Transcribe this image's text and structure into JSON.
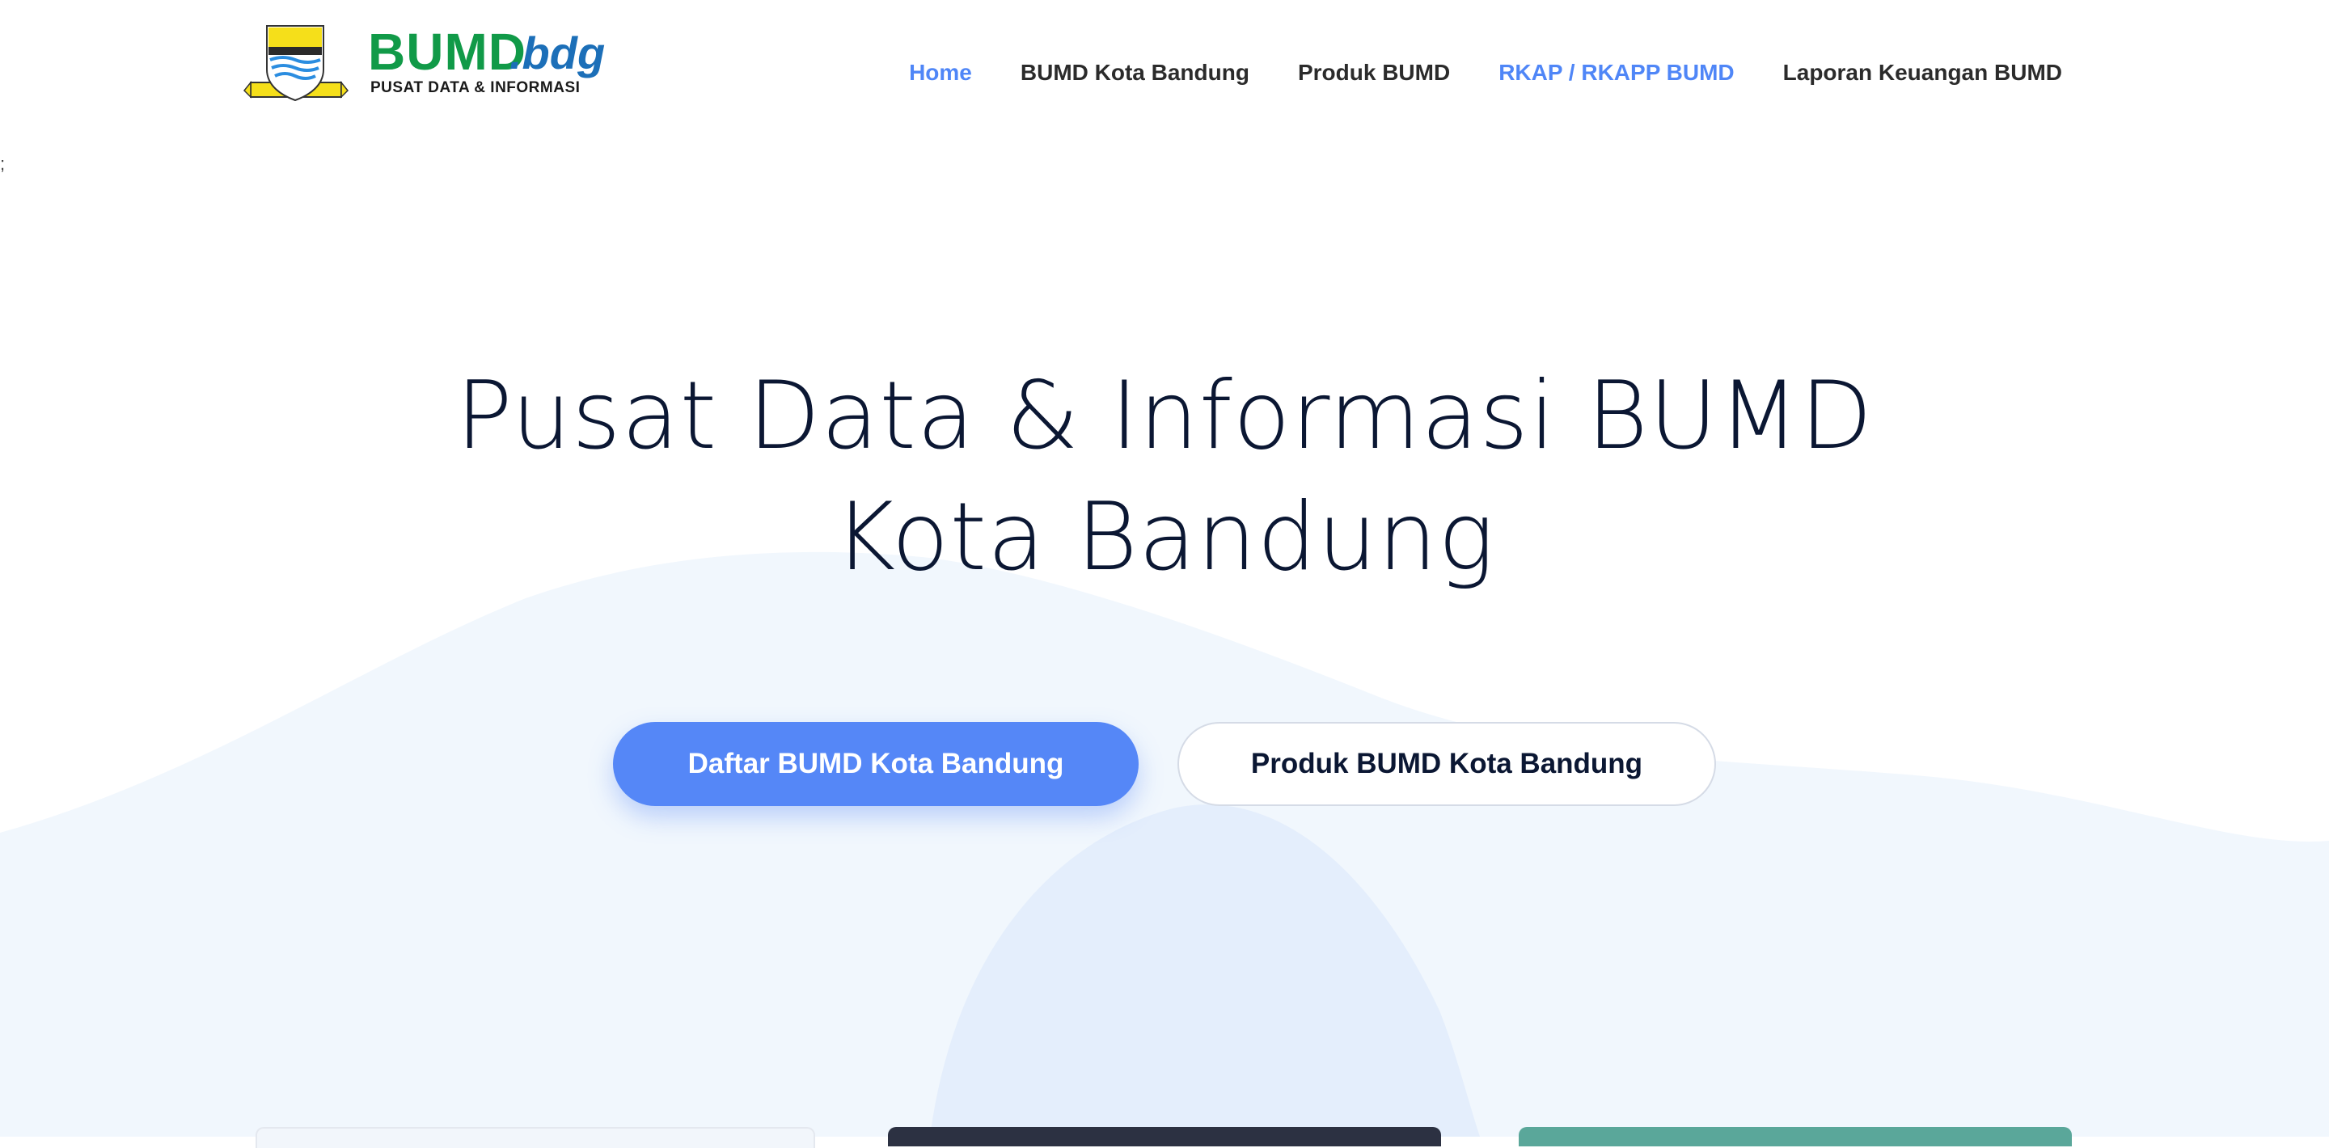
{
  "header": {
    "logo": {
      "emblem": "bandung-city-emblem",
      "brand": "BUMD",
      "brand_suffix": ".bdg",
      "subtitle": "PUSAT DATA & INFORMASI"
    },
    "nav": [
      {
        "label": "Home",
        "state": "active"
      },
      {
        "label": "BUMD Kota Bandung",
        "state": "normal"
      },
      {
        "label": "Produk BUMD",
        "state": "normal"
      },
      {
        "label": "RKAP / RKAPP BUMD",
        "state": "highlight"
      },
      {
        "label": "Laporan Keuangan BUMD",
        "state": "normal"
      }
    ]
  },
  "stray_text": ";",
  "hero": {
    "title_line1": "Pusat Data & Informasi BUMD",
    "title_line2": "Kota Bandung",
    "primary_button": "Daftar BUMD Kota Bandung",
    "secondary_button": "Produk BUMD Kota Bandung"
  },
  "colors": {
    "accent": "#5587f7",
    "nav_active": "#4f86f7",
    "brand_green": "#119a48",
    "brand_blue": "#1c6fb8",
    "title": "#0b1733",
    "wave_light": "#eef5fd"
  }
}
